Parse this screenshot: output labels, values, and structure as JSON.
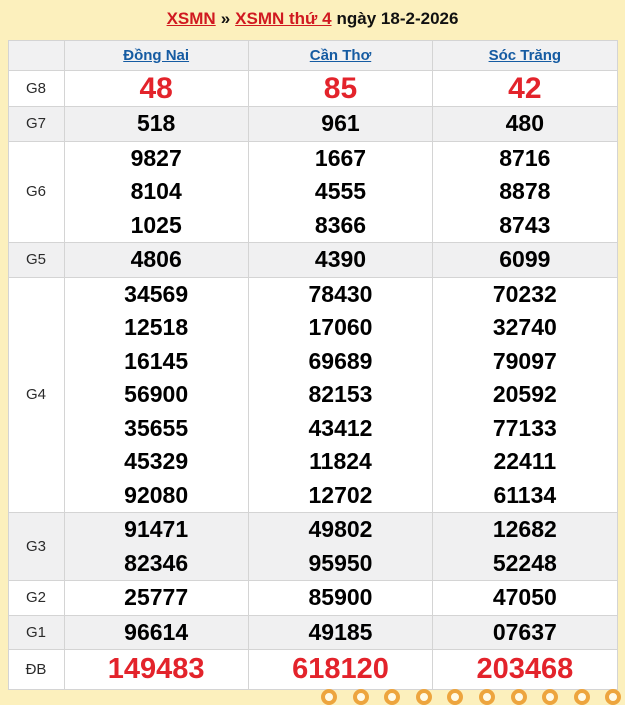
{
  "page": {
    "background_color": "#fcf0bd",
    "link_red_color": "#d01920",
    "number_red_color": "#e3232b",
    "link_blue_color": "#155ba2",
    "shade_row_color": "#f0f0f1"
  },
  "title": {
    "link1": "XSMN",
    "separator": "»",
    "link2": "XSMN thứ 4",
    "date_text": "ngày 18-2-2026"
  },
  "table": {
    "columns": [
      "Đồng Nai",
      "Cần Thơ",
      "Sóc Trăng"
    ],
    "rows": [
      {
        "label": "G8",
        "big": true,
        "shade": false,
        "values": [
          [
            "48"
          ],
          [
            "85"
          ],
          [
            "42"
          ]
        ]
      },
      {
        "label": "G7",
        "big": false,
        "shade": true,
        "values": [
          [
            "518"
          ],
          [
            "961"
          ],
          [
            "480"
          ]
        ]
      },
      {
        "label": "G6",
        "big": false,
        "shade": false,
        "values": [
          [
            "9827",
            "8104",
            "1025"
          ],
          [
            "1667",
            "4555",
            "8366"
          ],
          [
            "8716",
            "8878",
            "8743"
          ]
        ]
      },
      {
        "label": "G5",
        "big": false,
        "shade": true,
        "values": [
          [
            "4806"
          ],
          [
            "4390"
          ],
          [
            "6099"
          ]
        ]
      },
      {
        "label": "G4",
        "big": false,
        "shade": false,
        "values": [
          [
            "34569",
            "12518",
            "16145",
            "56900",
            "35655",
            "45329",
            "92080"
          ],
          [
            "78430",
            "17060",
            "69689",
            "82153",
            "43412",
            "11824",
            "12702"
          ],
          [
            "70232",
            "32740",
            "79097",
            "20592",
            "77133",
            "22411",
            "61134"
          ]
        ]
      },
      {
        "label": "G3",
        "big": false,
        "shade": true,
        "values": [
          [
            "91471",
            "82346"
          ],
          [
            "49802",
            "95950"
          ],
          [
            "12682",
            "52248"
          ]
        ]
      },
      {
        "label": "G2",
        "big": false,
        "shade": false,
        "values": [
          [
            "25777"
          ],
          [
            "85900"
          ],
          [
            "47050"
          ]
        ]
      },
      {
        "label": "G1",
        "big": false,
        "shade": true,
        "values": [
          [
            "96614"
          ],
          [
            "49185"
          ],
          [
            "07637"
          ]
        ]
      },
      {
        "label": "ĐB",
        "big": true,
        "shade": false,
        "values": [
          [
            "149483"
          ],
          [
            "618120"
          ],
          [
            "203468"
          ]
        ]
      }
    ]
  },
  "decor": {
    "ball_icon_count": 10,
    "ball_color": "#eda53e"
  }
}
